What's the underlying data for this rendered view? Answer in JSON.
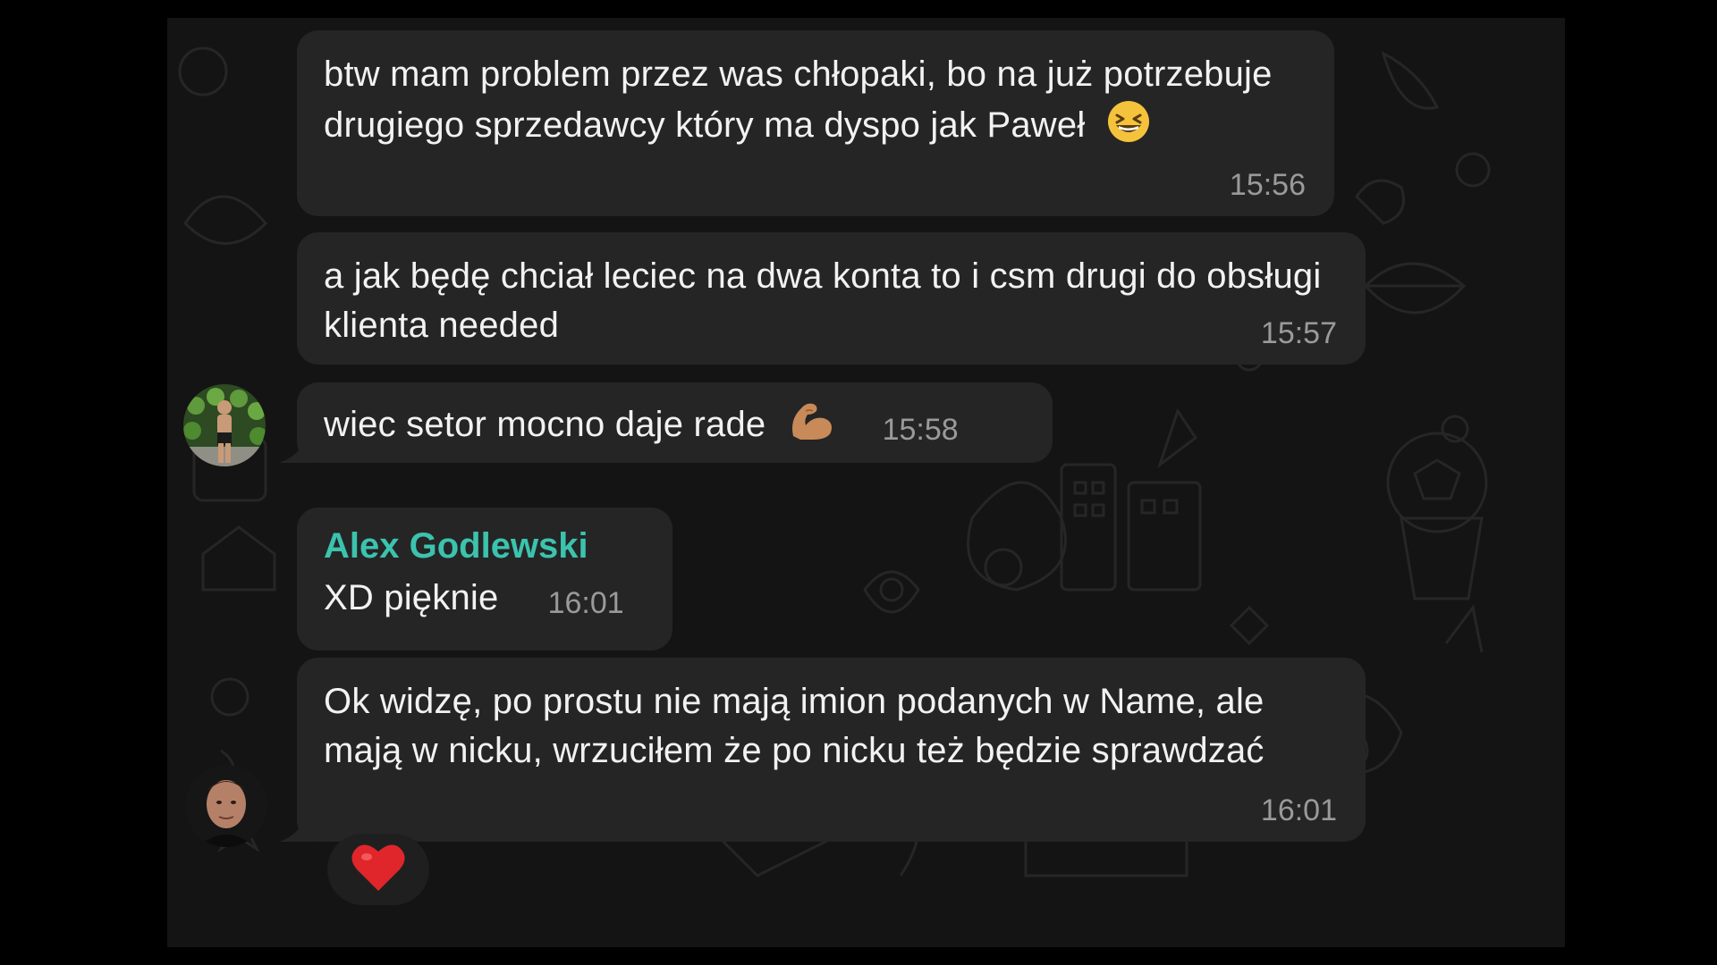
{
  "messages": [
    {
      "text": "btw mam problem przez was chłopaki, bo na już potrzebuje drugiego sprzedawcy który ma dyspo jak Paweł",
      "emoji": "grinning-squinting-face",
      "time": "15:56"
    },
    {
      "text": "a jak będę chciał leciec na dwa konta to i csm drugi do obsługi klienta needed",
      "time": "15:57"
    },
    {
      "text": "wiec setor mocno daje rade",
      "emoji": "flexed-biceps",
      "time": "15:58"
    },
    {
      "sender": "Alex Godlewski",
      "text": "XD pięknie",
      "time": "16:01"
    },
    {
      "text": "Ok widzę, po prostu nie mają imion podanych w Name, ale mają w nicku, wrzuciłem że po nicku też będzie sprawdzać",
      "time": "16:01",
      "reaction": "red-heart"
    }
  ],
  "colors": {
    "background": "#141414",
    "bubble": "#252525",
    "text": "#f2f2f2",
    "time": "#9a9a9a",
    "sender_name": "#3bc3ae",
    "reaction_heart": "#e0262b"
  }
}
